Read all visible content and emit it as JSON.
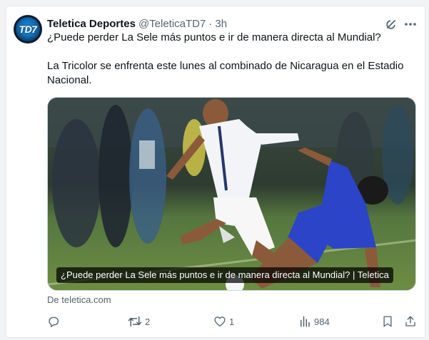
{
  "tweet": {
    "author_name": "Teletica Deportes",
    "author_handle": "@TeleticaTD7",
    "separator": "·",
    "time": "3h",
    "avatar_text": "TD7",
    "text_line1": "¿Puede perder La Sele más puntos e ir de manera directa al Mundial?",
    "text_line2": "La Tricolor se enfrenta este lunes al combinado de Nicaragua en el Estadio Nacional.",
    "media_caption": "¿Puede perder La Sele más puntos e ir de manera directa al Mundial? | Teletica",
    "media_description_icon": "soccer-photo",
    "source": "De teletica.com"
  },
  "actions": {
    "reply_count": "",
    "repost_count": "2",
    "like_count": "1",
    "views_count": "984"
  },
  "icons": {
    "grok": "grok-icon",
    "more": "more-icon",
    "reply": "reply-icon",
    "repost": "repost-icon",
    "like": "heart-icon",
    "views": "views-icon",
    "bookmark": "bookmark-icon",
    "share": "share-icon"
  },
  "colors": {
    "text": "#0f1419",
    "secondary": "#536471",
    "border": "#e6e9eb"
  }
}
